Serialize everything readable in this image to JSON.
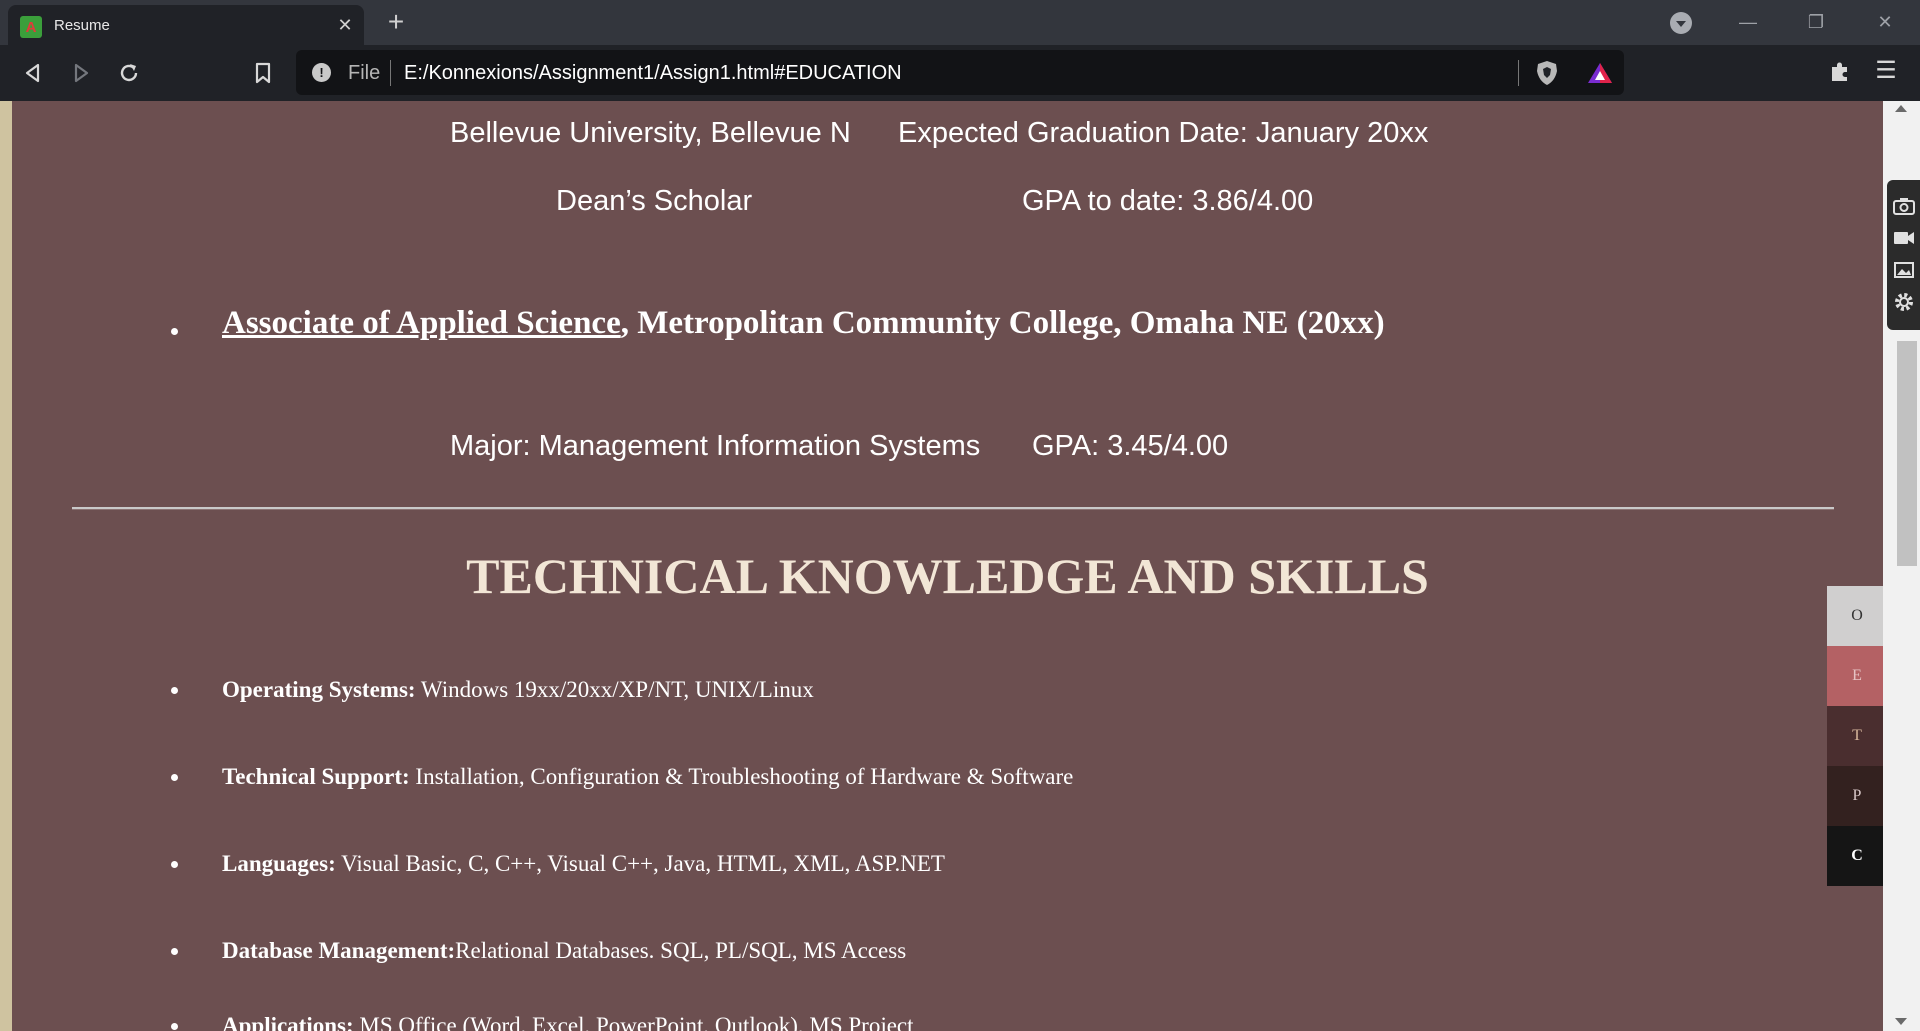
{
  "browser": {
    "tab_title": "Resume",
    "tab_favicon_letter": "A",
    "new_tab_label": "+",
    "address_scheme_label": "File",
    "url": "E:/Konnexions/Assignment1/Assign1.html#EDUCATION"
  },
  "education": {
    "bellevue_line_left": "Bellevue University, Bellevue N",
    "bellevue_line_right": "Expected Graduation Date: January 20xx",
    "honor": "Dean’s Scholar",
    "gpa_to_date": "GPA to date: 3.86/4.00",
    "associate_degree_link": "Associate of Applied Science",
    "associate_rest": ", Metropolitan Community College, Omaha NE (20xx)",
    "major": "Major: Management Information Systems",
    "major_gpa": "GPA: 3.45/4.00"
  },
  "skills_section": {
    "title": "TECHNICAL KNOWLEDGE AND SKILLS",
    "items": [
      {
        "label": "Operating Systems:",
        "value": " Windows 19xx/20xx/XP/NT, UNIX/Linux"
      },
      {
        "label": "Technical Support:",
        "value": " Installation, Configuration & Troubleshooting of Hardware & Software"
      },
      {
        "label": "Languages:",
        "value": " Visual Basic, C, C++, Visual C++, Java, HTML, XML, ASP.NET"
      },
      {
        "label": "Database Management:",
        "value": "Relational Databases. SQL, PL/SQL, MS Access"
      },
      {
        "label": "Applications:",
        "value": " MS Office (Word, Excel, PowerPoint, Outlook), MS Project"
      }
    ]
  },
  "quick_nav": [
    {
      "letter": "O",
      "bg": "#d0cfcf",
      "fg": "#333333"
    },
    {
      "letter": "E",
      "bg": "#b46164",
      "fg": "#e6c3c4"
    },
    {
      "letter": "T",
      "bg": "#4a2e2f",
      "fg": "#d7b79c"
    },
    {
      "letter": "P",
      "bg": "#33211f",
      "fg": "#d9c8c8"
    },
    {
      "letter": "C",
      "bg": "#151515",
      "fg": "#ffffff"
    }
  ],
  "colors": {
    "page_bg": "#6c4f50",
    "title_color": "#f2e6d6",
    "chrome_bg": "#202227"
  },
  "icons": [
    "favicon-icon",
    "close-icon",
    "plus-icon",
    "tab-dropdown-icon",
    "back-icon",
    "forward-icon",
    "reload-icon",
    "bookmark-icon",
    "info-icon",
    "brave-shield-icon",
    "brave-rewards-icon",
    "extensions-icon",
    "menu-icon",
    "camera-icon",
    "video-icon",
    "gallery-icon",
    "settings-icon"
  ]
}
